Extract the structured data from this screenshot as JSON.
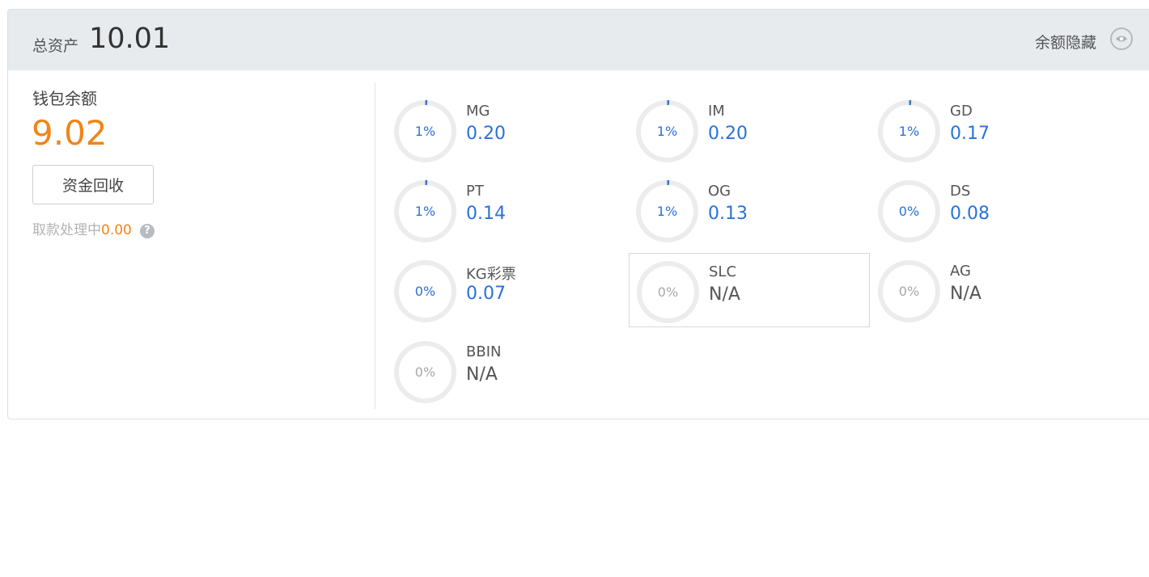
{
  "header": {
    "total_label": "总资产",
    "total_value": "10.01",
    "hide_label": "余额隐藏",
    "hide_icon": "eye-icon"
  },
  "wallet": {
    "label": "钱包余额",
    "value": "9.02",
    "recover_button": "资金回收",
    "pending_label": "取款处理中",
    "pending_value": "0.00",
    "help_icon": "question-icon",
    "help_glyph": "?"
  },
  "colors": {
    "accent": "#2a73d8",
    "orange": "#f08519",
    "ring_bg": "#ececec"
  },
  "platforms": [
    {
      "name": "MG",
      "percent": "1%",
      "balance": "0.20",
      "active": true
    },
    {
      "name": "IM",
      "percent": "1%",
      "balance": "0.20",
      "active": true
    },
    {
      "name": "GD",
      "percent": "1%",
      "balance": "0.17",
      "active": true
    },
    {
      "name": "PT",
      "percent": "1%",
      "balance": "0.14",
      "active": true
    },
    {
      "name": "OG",
      "percent": "1%",
      "balance": "0.13",
      "active": true
    },
    {
      "name": "DS",
      "percent": "0%",
      "balance": "0.08",
      "active": true
    },
    {
      "name": "KG彩票",
      "percent": "0%",
      "balance": "0.07",
      "active": true
    },
    {
      "name": "SLC",
      "percent": "0%",
      "balance": "N/A",
      "active": false,
      "selected": true
    },
    {
      "name": "AG",
      "percent": "0%",
      "balance": "N/A",
      "active": false
    },
    {
      "name": "BBIN",
      "percent": "0%",
      "balance": "N/A",
      "active": false
    }
  ]
}
